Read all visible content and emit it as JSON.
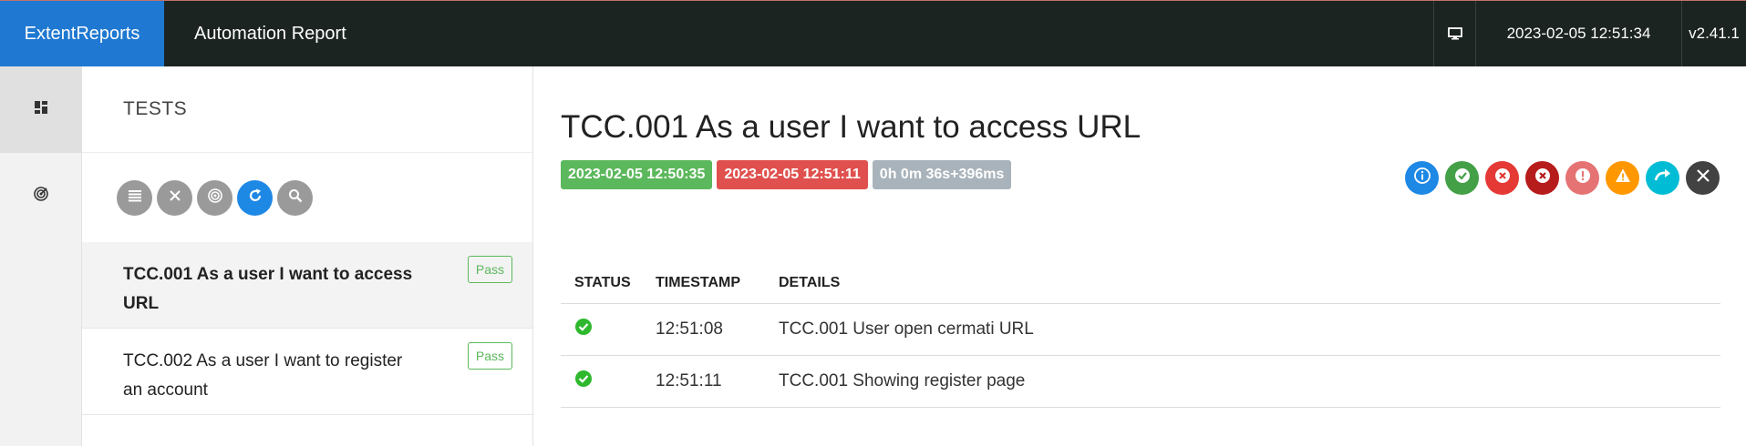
{
  "header": {
    "brand": "ExtentReports",
    "title": "Automation Report",
    "monitor_icon": "monitor-icon",
    "datetime": "2023-02-05 12:51:34",
    "version": "v2.41.1"
  },
  "nav": {
    "items": [
      {
        "icon": "dashboard-icon",
        "active": true
      },
      {
        "icon": "radar-icon",
        "active": false
      }
    ]
  },
  "tests_panel": {
    "heading": "TESTS",
    "toolbar": [
      {
        "icon": "list-icon",
        "color": "#9a9a9a"
      },
      {
        "icon": "close-icon",
        "color": "#9a9a9a"
      },
      {
        "icon": "radar-icon",
        "color": "#9a9a9a"
      },
      {
        "icon": "refresh-icon",
        "color": "#1e88e5"
      },
      {
        "icon": "search-icon",
        "color": "#9a9a9a"
      }
    ],
    "tests": [
      {
        "name": "TCC.001 As a user I want to access URL",
        "status": "Pass"
      },
      {
        "name": "TCC.002 As a user I want to register an account",
        "status": "Pass"
      }
    ]
  },
  "detail": {
    "title": "TCC.001 As a user I want to access URL",
    "start_time": "2023-02-05 12:50:35",
    "end_time": "2023-02-05 12:51:11",
    "duration": "0h 0m 36s+396ms",
    "status_filters": [
      {
        "icon": "info-icon",
        "color": "#1e88e5"
      },
      {
        "icon": "pass-icon",
        "color": "#43a047"
      },
      {
        "icon": "fail-icon",
        "color": "#e53935"
      },
      {
        "icon": "fatal-icon",
        "color": "#b71c1c"
      },
      {
        "icon": "error-icon",
        "color": "#e57373"
      },
      {
        "icon": "warning-icon",
        "color": "#ff9800"
      },
      {
        "icon": "skip-icon",
        "color": "#00bcd4"
      },
      {
        "icon": "clear-icon",
        "color": "#424242"
      }
    ],
    "log_headers": {
      "status": "STATUS",
      "timestamp": "TIMESTAMP",
      "details": "DETAILS"
    },
    "logs": [
      {
        "status": "pass",
        "timestamp": "12:51:08",
        "details": "TCC.001 User open cermati URL"
      },
      {
        "status": "pass",
        "timestamp": "12:51:11",
        "details": "TCC.001 Showing register page"
      }
    ]
  },
  "colors": {
    "topbar": "#1c2421",
    "brand": "#1f78d1",
    "pass": "#5cb85c",
    "fail": "#e0504e"
  }
}
